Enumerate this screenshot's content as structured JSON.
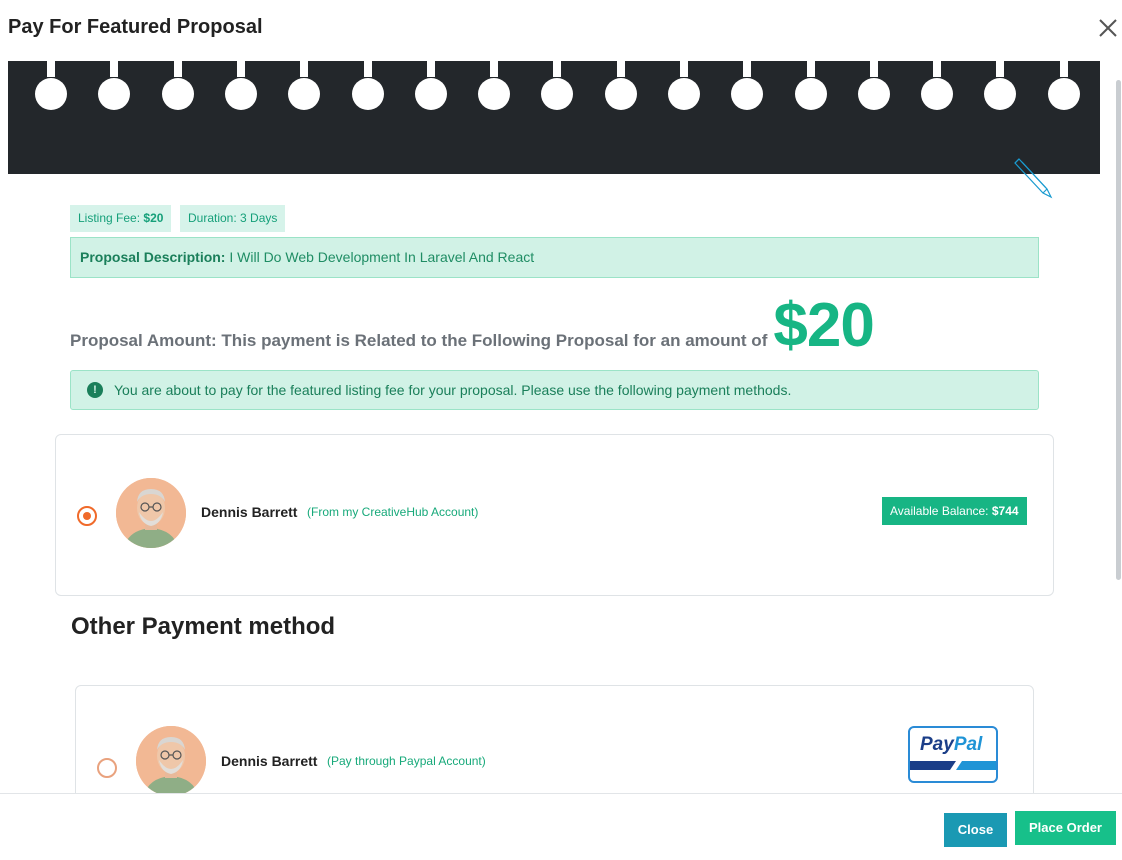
{
  "modal": {
    "title": "Pay For Featured Proposal"
  },
  "tags": {
    "listing_fee_label": "Listing Fee:",
    "listing_fee_value": "$20",
    "duration": "Duration: 3 Days"
  },
  "description": {
    "label": "Proposal Description:",
    "text": "I Will Do Web Development In Laravel And React"
  },
  "amount": {
    "label": "Proposal Amount: This payment is Related to the Following Proposal for an amount of",
    "value": "$20"
  },
  "alert": {
    "icon": "!",
    "text": "You are about to pay for the featured listing fee for your proposal. Please use the following payment methods."
  },
  "account_payment": {
    "name": "Dennis Barrett",
    "note": "(From my CreativeHub Account)",
    "balance_label": "Available Balance:",
    "balance_value": "$744",
    "selected": true
  },
  "other_methods": {
    "heading": "Other Payment method",
    "paypal": {
      "name": "Dennis Barrett",
      "note": "(Pay through Paypal Account)",
      "logo_text_1": "Pay",
      "logo_text_2": "Pal",
      "selected": false
    }
  },
  "footer": {
    "close_label": "Close",
    "order_label": "Place Order"
  },
  "colors": {
    "accent": "#17b584",
    "radio": "#f06a2a",
    "banner": "#23272b",
    "close_button": "#1a99b3"
  }
}
